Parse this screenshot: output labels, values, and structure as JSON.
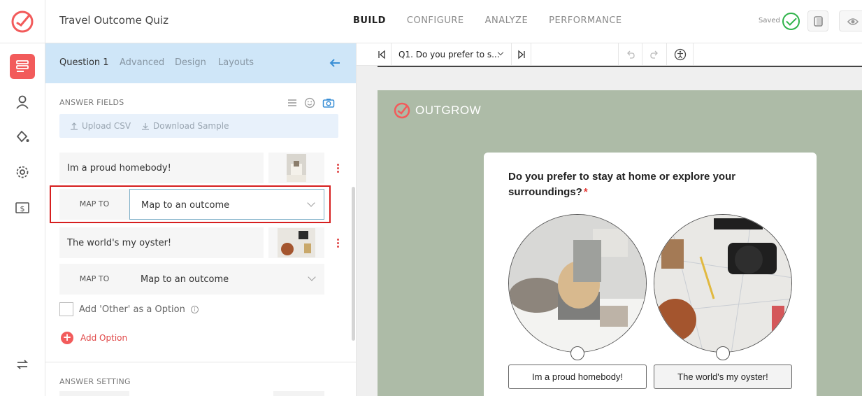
{
  "app": {
    "title": "Travel Outcome Quiz",
    "brand_color": "#f25b5b",
    "saved_label": "Saved"
  },
  "nav": {
    "items": [
      "BUILD",
      "CONFIGURE",
      "ANALYZE",
      "PERFORMANCE"
    ],
    "active": "BUILD"
  },
  "panel": {
    "tabs": [
      "Question 1",
      "Advanced",
      "Design",
      "Layouts"
    ],
    "active_tab": "Question 1",
    "answer_fields_label": "ANSWER FIELDS",
    "upload_csv": "Upload CSV",
    "download_sample": "Download Sample",
    "options": [
      {
        "text": "Im a proud homebody!",
        "map_label": "MAP TO",
        "map_value": "Map to an outcome"
      },
      {
        "text": "The world's my oyster!",
        "map_label": "MAP TO",
        "map_value": "Map to an outcome"
      }
    ],
    "other_option": "Add 'Other' as a Option",
    "add_option": "Add Option",
    "answer_setting_label": "ANSWER SETTING"
  },
  "preview": {
    "question_select": "Q1. Do you prefer to s...",
    "brand_name": "OUTGROW",
    "question": "Do you prefer to stay at home or explore your surroundings?",
    "required_mark": "*",
    "choices": [
      "Im a proud homebody!",
      "The world's my oyster!"
    ],
    "canvas_color": "#adbba7"
  }
}
